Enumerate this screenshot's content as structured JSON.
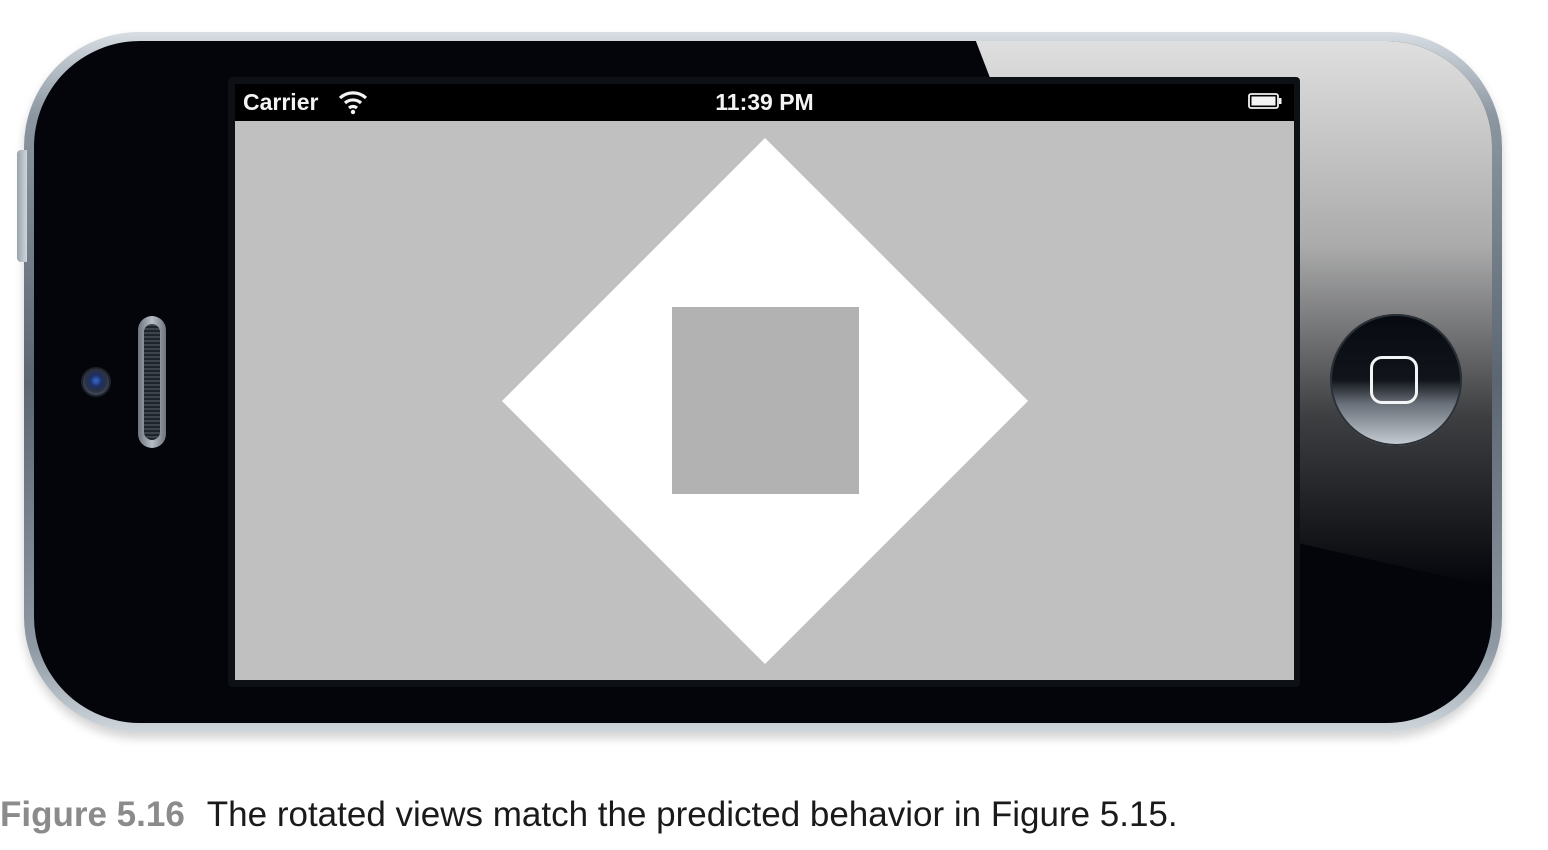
{
  "statusbar": {
    "carrier": "Carrier",
    "time": "11:39 PM",
    "wifi_icon": "wifi-icon",
    "battery_icon": "battery-icon"
  },
  "device": {
    "home_button_icon": "home-button-icon"
  },
  "colors": {
    "screen_background": "#c0c0c0",
    "diamond": "#ffffff",
    "inner_square": "#b2b2b2",
    "statusbar_background": "#000000"
  },
  "caption": {
    "figure_label": "Figure 5.16",
    "text": "The rotated views match the predicted behavior in Figure 5.15."
  }
}
